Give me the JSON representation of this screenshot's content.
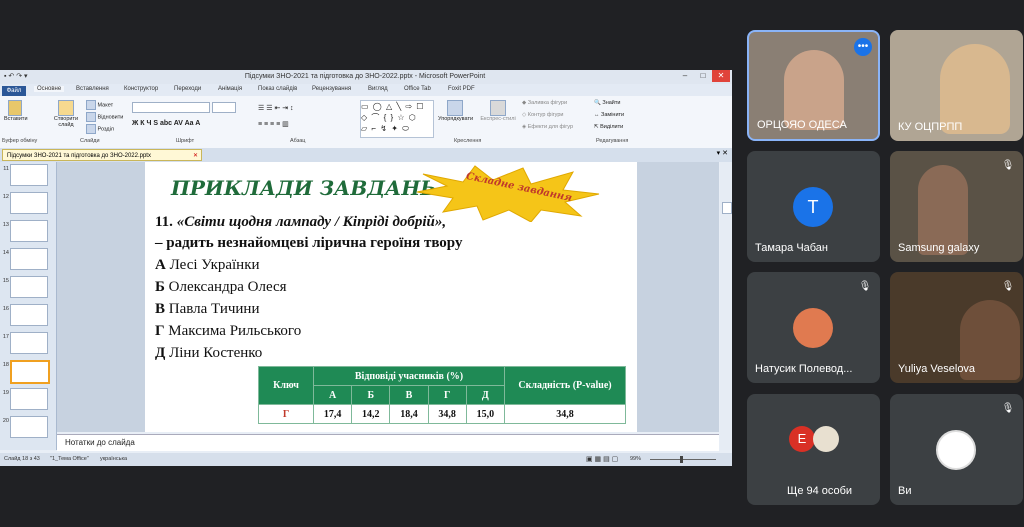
{
  "ppt": {
    "window_title": "Підсумки ЗНО-2021 та підготовка до ЗНО-2022.pptx - Microsoft PowerPoint",
    "tabs": [
      "Файл",
      "Основне",
      "Вставлення",
      "Конструктор",
      "Переходи",
      "Анімація",
      "Показ слайдів",
      "Рецензування",
      "Вигляд",
      "Office Tab",
      "Foxit PDF"
    ],
    "ribbon": {
      "paste": "Вставити",
      "create_slide": "Створити слайд",
      "layout": "Макет",
      "reset": "Відновити",
      "section": "Розділ",
      "group_clipboard": "Буфер обміну",
      "group_slides": "Слайди",
      "group_font": "Шрифт",
      "group_paragraph": "Абзац",
      "group_drawing": "Креслення",
      "group_editing": "Редагування",
      "arrange": "Упорядкувати",
      "quick_styles": "Експрес-стилі",
      "shape_fill": "Заливка фігури",
      "shape_outline": "Контур фігури",
      "shape_effects": "Ефекти для фігур",
      "find": "Знайти",
      "replace": "Замінити",
      "select": "Виділити"
    },
    "doc_tab": "Підсумки ЗНО-2021 та підготовка до ЗНО-2022.pptx",
    "thumb_numbers": [
      "11",
      "12",
      "13",
      "14",
      "15",
      "16",
      "17",
      "18",
      "19",
      "20"
    ],
    "slide": {
      "title": "ПРИКЛАДИ ЗАВДАНЬ",
      "burst": "Складне завдання",
      "q_num": "11.",
      "q_quote": "«Світи щодня лампаду / Кіпріді добрій»,",
      "q_line2": "– радить незнайомцеві лірична героїня твору",
      "options": [
        {
          "letter": "А",
          "text": "Лесі Українки"
        },
        {
          "letter": "Б",
          "text": "Олександра Олеся"
        },
        {
          "letter": "В",
          "text": "Павла Тичини"
        },
        {
          "letter": "Г",
          "text": "Максима Рильського"
        },
        {
          "letter": "Д",
          "text": "Ліни Костенко"
        }
      ],
      "table": {
        "key_header": "Ключ",
        "answers_header": "Відповіді учасників (%)",
        "difficulty_header": "Складність (P-value)",
        "letters": [
          "А",
          "Б",
          "В",
          "Г",
          "Д"
        ],
        "key": "Г",
        "values": [
          "17,4",
          "14,2",
          "18,4",
          "34,8",
          "15,0"
        ],
        "difficulty": "34,8"
      }
    },
    "notes": "Нотатки до слайда",
    "status": {
      "slide": "Слайд 18 з 43",
      "theme": "\"1_Тема Office\"",
      "lang": "українська",
      "zoom": "99%"
    }
  },
  "participants": [
    {
      "name": "ОРЦОЯО ОДЕСА",
      "type": "video"
    },
    {
      "name": "КУ ОЦПРПП",
      "type": "video"
    },
    {
      "name": "Тамара Чабан",
      "initial": "Т",
      "color": "#1a73e8"
    },
    {
      "name": "Samsung galaxy",
      "type": "video"
    },
    {
      "name": "Натусик Полевод...",
      "type": "avatar"
    },
    {
      "name": "Yuliya Veselova",
      "type": "video"
    },
    {
      "name": "Ще 94 особи",
      "initial": "Е",
      "color": "#d93025"
    },
    {
      "name": "Ви",
      "type": "avatar"
    }
  ]
}
